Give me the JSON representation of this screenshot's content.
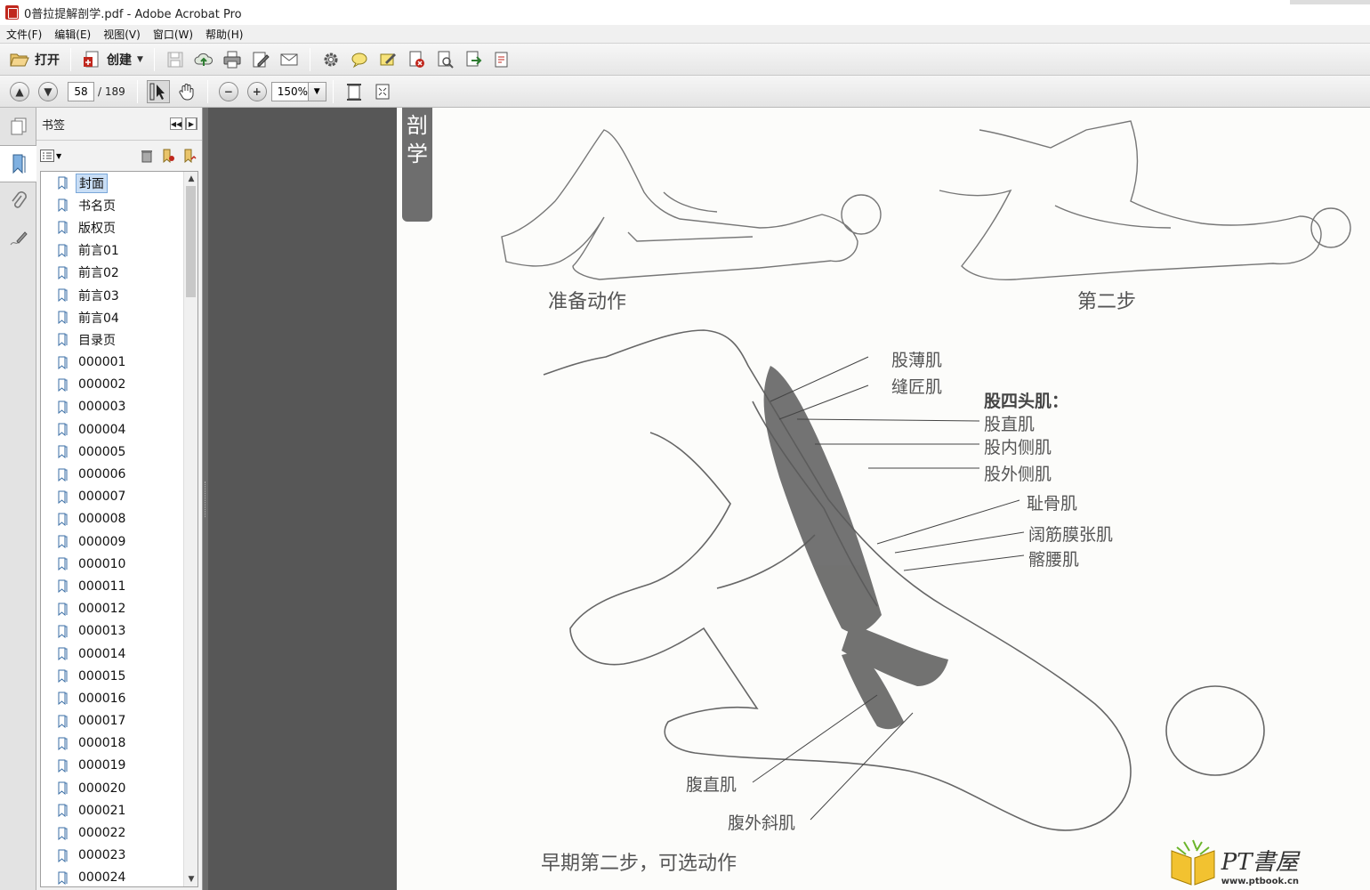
{
  "window": {
    "title": "0普拉提解剖学.pdf - Adobe Acrobat Pro"
  },
  "menu": [
    "文件(F)",
    "编辑(E)",
    "视图(V)",
    "窗口(W)",
    "帮助(H)"
  ],
  "toolbar": {
    "open_label": "打开",
    "create_label": "创建"
  },
  "nav": {
    "current_page": "58",
    "total_pages": "/ 189",
    "zoom": "150%"
  },
  "panel": {
    "title": "书签"
  },
  "bookmarks": [
    "封面",
    "书名页",
    "版权页",
    "前言01",
    "前言02",
    "前言03",
    "前言04",
    "目录页",
    "000001",
    "000002",
    "000003",
    "000004",
    "000005",
    "000006",
    "000007",
    "000008",
    "000009",
    "000010",
    "000011",
    "000012",
    "000013",
    "000014",
    "000015",
    "000016",
    "000017",
    "000018",
    "000019",
    "000020",
    "000021",
    "000022",
    "000023",
    "000024"
  ],
  "document": {
    "side_tab": [
      "剖",
      "学"
    ],
    "caption_prep": "准备动作",
    "caption_step2": "第二步",
    "caption_bottom": "早期第二步，可选动作",
    "muscles": {
      "gracilis": "股薄肌",
      "sartorius": "缝匠肌",
      "quad_group": "股四头肌：",
      "rectus_femoris": "股直肌",
      "vastus_medialis": "股内侧肌",
      "vastus_lateralis": "股外侧肌",
      "pectineus": "耻骨肌",
      "tfl": "阔筋膜张肌",
      "iliopsoas": "髂腰肌",
      "rectus_abdominis": "腹直肌",
      "external_oblique": "腹外斜肌"
    },
    "watermark_title": "PT書屋",
    "watermark_url": "www.ptbook.cn"
  },
  "colors": {
    "accent_red": "#c0271d",
    "selection": "#c9def5",
    "gray_bg": "#575757"
  }
}
